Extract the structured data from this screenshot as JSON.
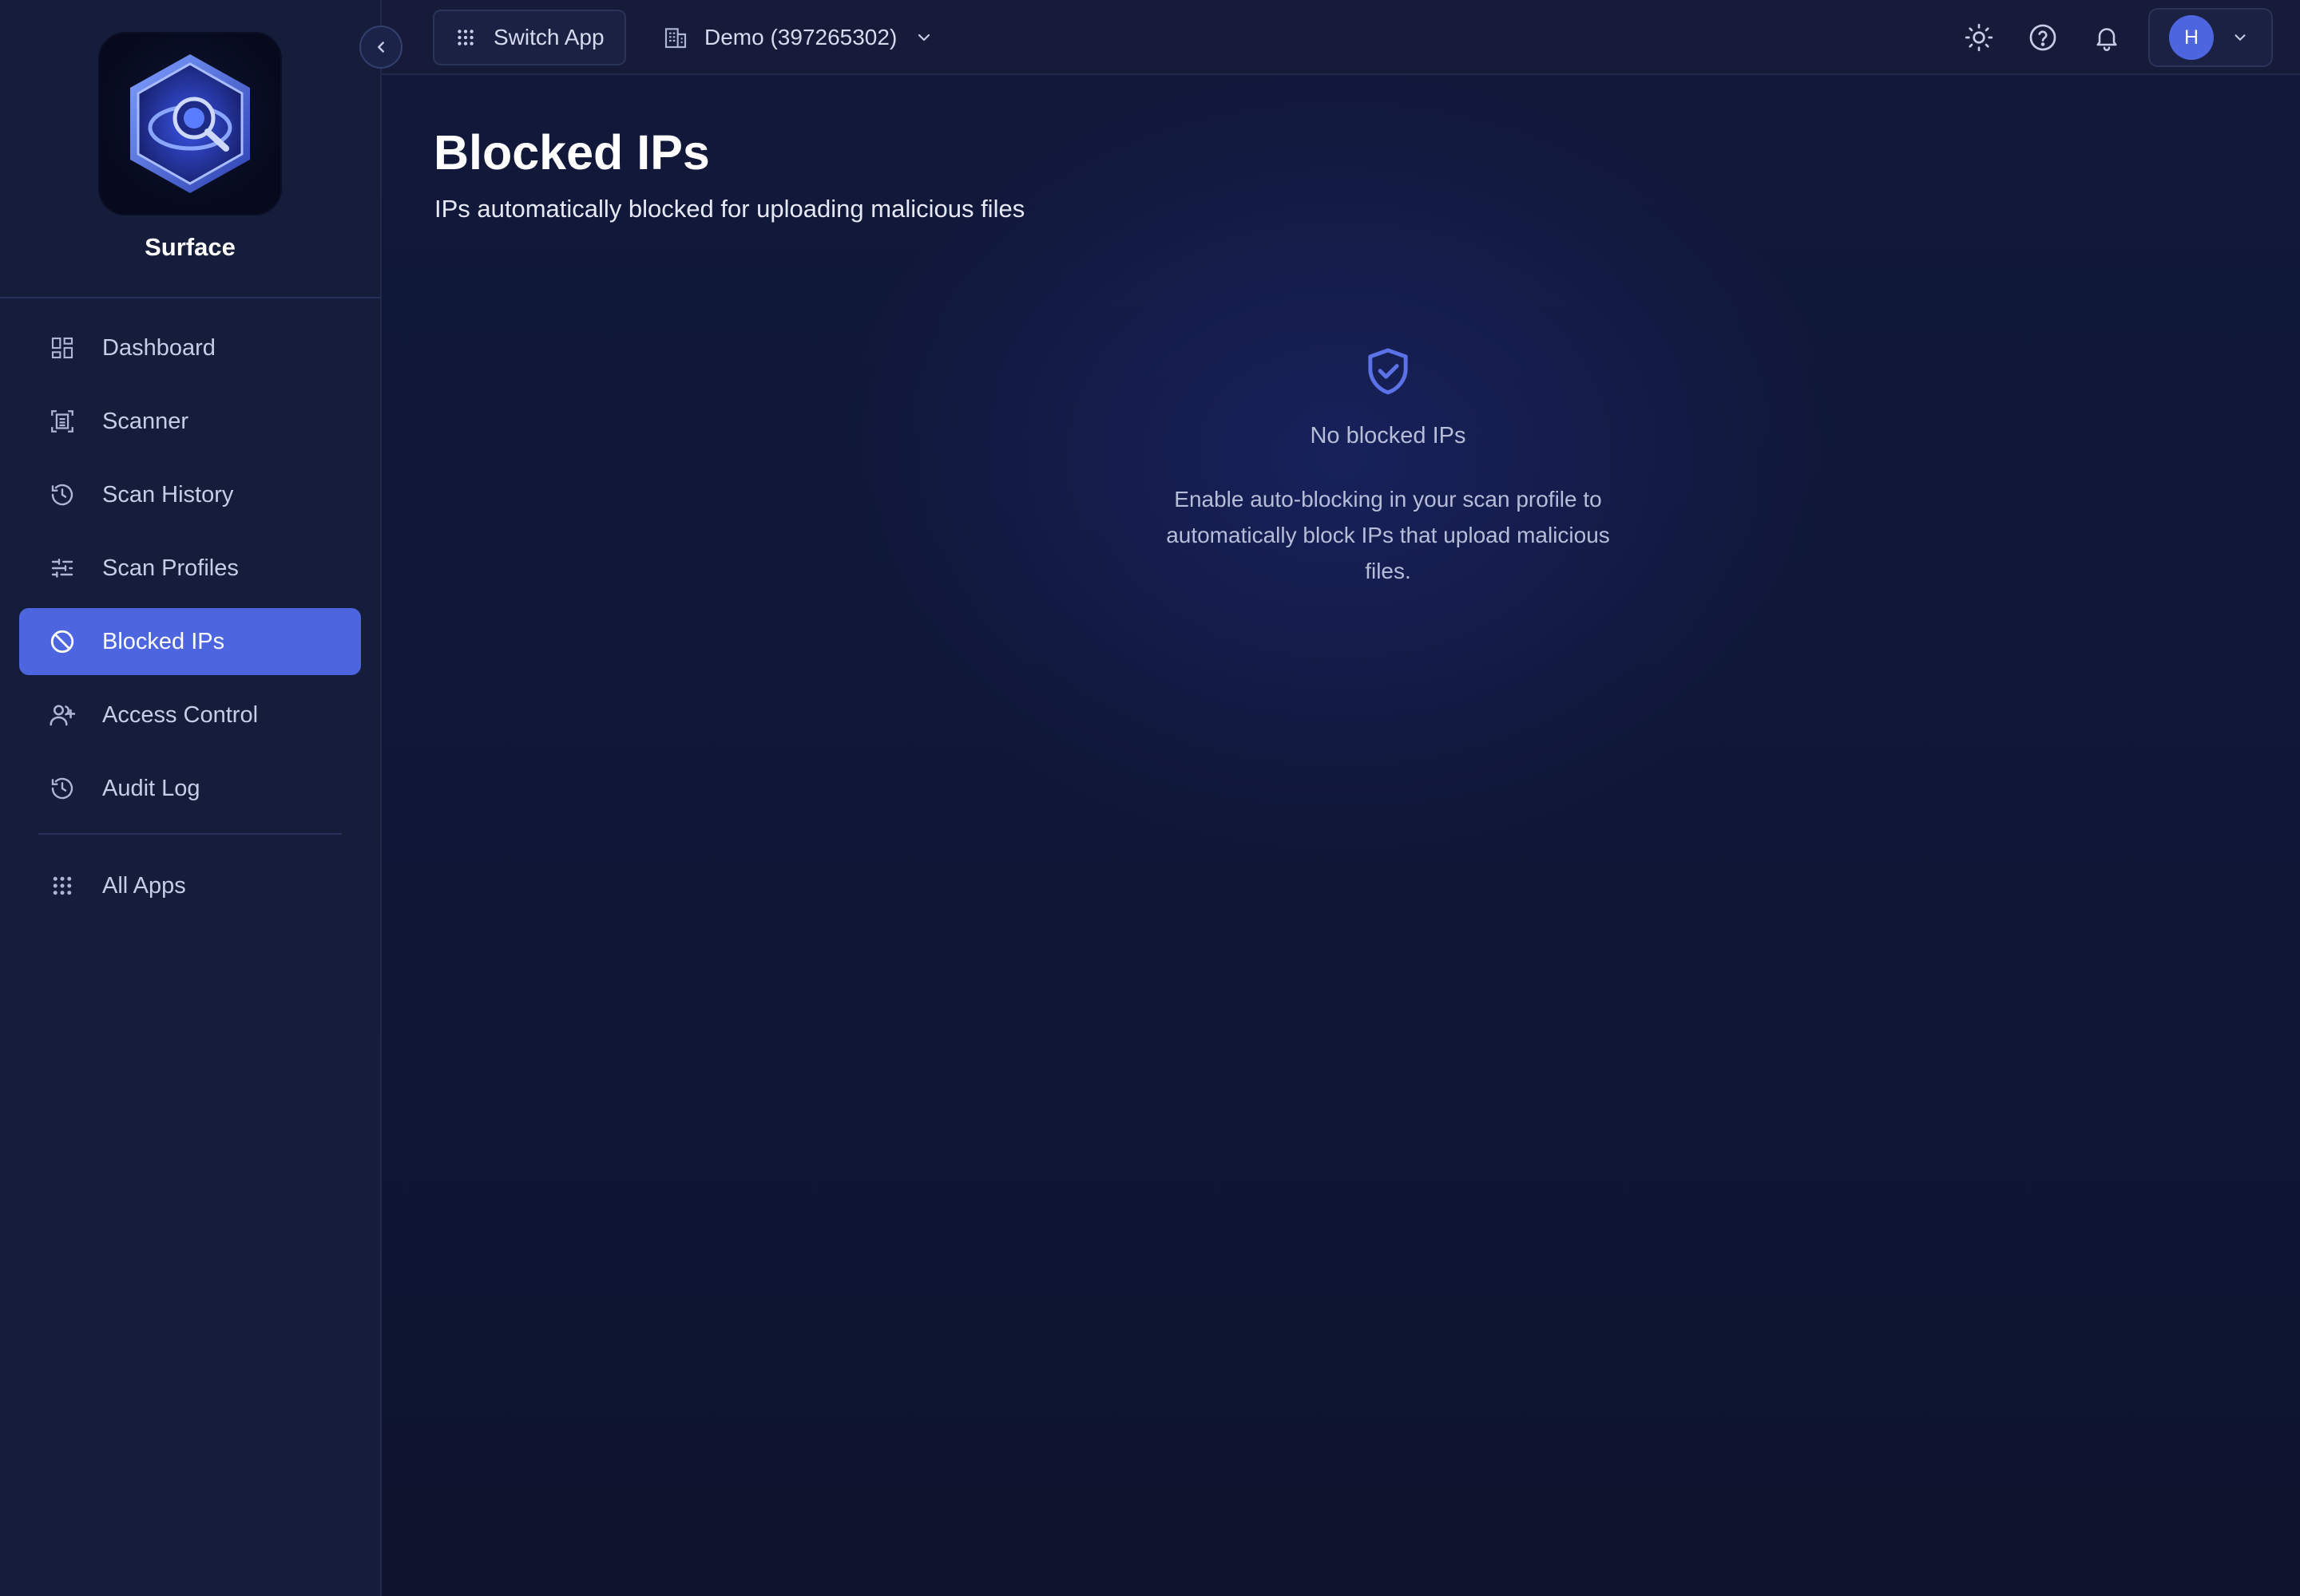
{
  "app": {
    "name": "Surface"
  },
  "sidebar": {
    "items": [
      {
        "label": "Dashboard",
        "icon": "dashboard-icon",
        "active": false
      },
      {
        "label": "Scanner",
        "icon": "scanner-icon",
        "active": false
      },
      {
        "label": "Scan History",
        "icon": "history-icon",
        "active": false
      },
      {
        "label": "Scan Profiles",
        "icon": "sliders-icon",
        "active": false
      },
      {
        "label": "Blocked IPs",
        "icon": "ban-icon",
        "active": true
      },
      {
        "label": "Access Control",
        "icon": "user-plus-icon",
        "active": false
      },
      {
        "label": "Audit Log",
        "icon": "history-icon",
        "active": false
      }
    ],
    "footer_item": {
      "label": "All Apps",
      "icon": "grid-icon"
    },
    "collapse_icon": "chevron-left-icon"
  },
  "topbar": {
    "switch_app_label": "Switch App",
    "org_label": "Demo (397265302)",
    "user_initial": "H",
    "icons": [
      "sun-icon",
      "help-icon",
      "bell-icon"
    ]
  },
  "page": {
    "title": "Blocked IPs",
    "subtitle": "IPs automatically blocked for uploading malicious files"
  },
  "empty_state": {
    "icon": "shield-check-icon",
    "title": "No blocked IPs",
    "description": "Enable auto-blocking in your scan profile to automatically block IPs that upload malicious files."
  },
  "colors": {
    "accent": "#4d66e0",
    "sidebar_bg": "#161d3b",
    "main_bg": "#11183a"
  }
}
